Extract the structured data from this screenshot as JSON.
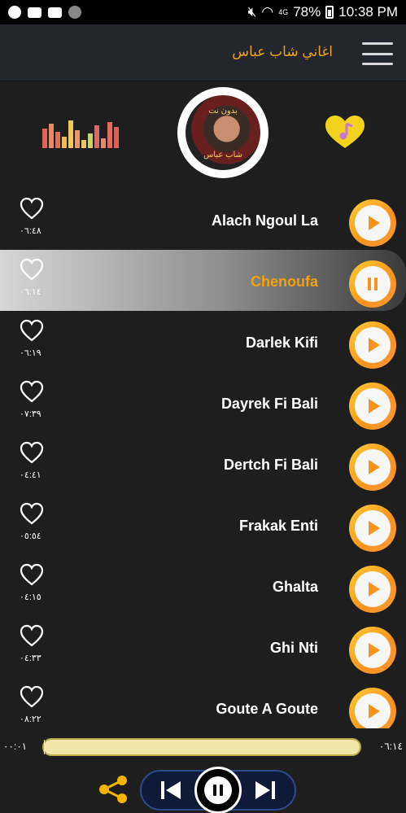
{
  "status_bar": {
    "battery": "78%",
    "time": "10:38 PM",
    "net_label": "4G"
  },
  "app_bar": {
    "title": "اغاني شاب عباس"
  },
  "header": {
    "avatar_caption_top": "بدون نت",
    "avatar_caption_bottom": "شاب عباس"
  },
  "songs": [
    {
      "title": "Alach Ngoul La",
      "duration": "٠٦:٤٨",
      "state": "play"
    },
    {
      "title": "Chenoufa",
      "duration": "٠٦:١٤",
      "state": "pause"
    },
    {
      "title": "Darlek Kifi",
      "duration": "٠٦:١٩",
      "state": "play"
    },
    {
      "title": "Dayrek Fi Bali",
      "duration": "٠٧:٣٩",
      "state": "play"
    },
    {
      "title": "Dertch Fi Bali",
      "duration": "٠٤:٤١",
      "state": "play"
    },
    {
      "title": "Frakak Enti",
      "duration": "٠٥:٥٤",
      "state": "play"
    },
    {
      "title": "Ghalta",
      "duration": "٠٤:١٥",
      "state": "play"
    },
    {
      "title": "Ghi Nti",
      "duration": "٠٤:٣٣",
      "state": "play"
    },
    {
      "title": "Goute A Goute",
      "duration": "٠٨:٢٢",
      "state": "play"
    }
  ],
  "player": {
    "elapsed": "٠٠:٠١",
    "total": "٠٦:١٤",
    "progress_fraction": 0.003
  },
  "colors": {
    "accent": "#f5a00f",
    "button_gradient_start": "#ffcc33",
    "button_gradient_end": "#f7931e"
  },
  "icons": {
    "favorite": "heart-outline-icon",
    "header_favorite": "heart-music-icon",
    "equalizer": "equalizer-icon",
    "share": "share-icon",
    "previous": "skip-previous-icon",
    "next": "skip-next-icon",
    "pause": "pause-icon",
    "play": "play-icon"
  }
}
